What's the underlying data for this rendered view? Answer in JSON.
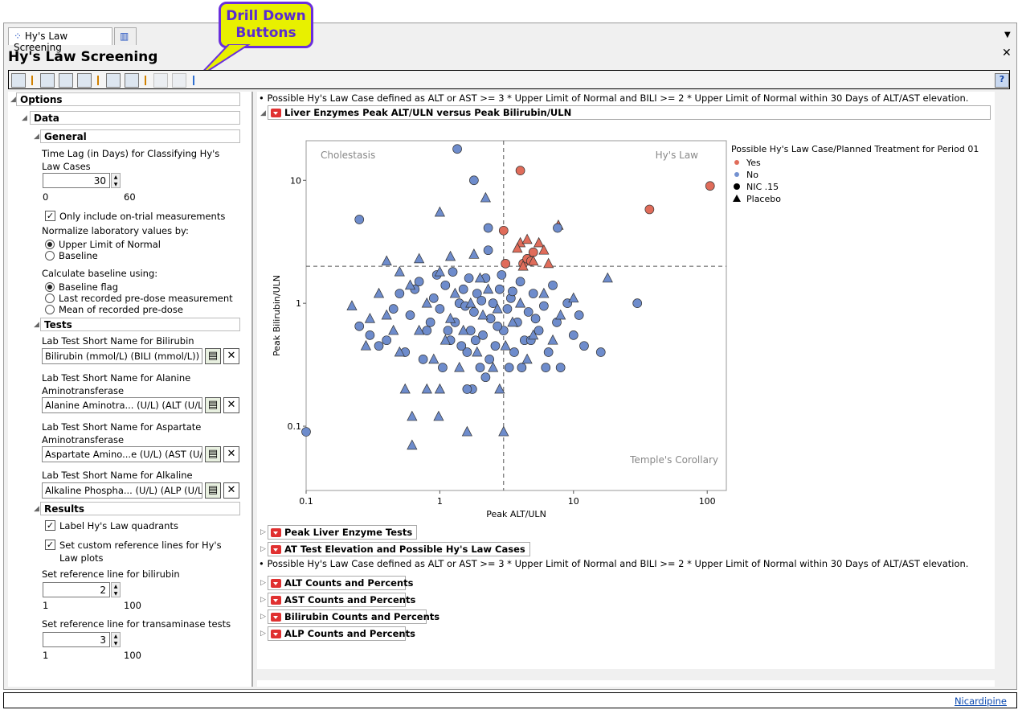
{
  "window": {
    "tab_label": "Hy's Law Screening",
    "title": "Hy's Law Screening",
    "callout": "Drill Down Buttons",
    "status_link": "Nicardipine"
  },
  "description": "Possible Hy's Law Case defined as ALT or AST >= 3 * Upper Limit of Normal and BILI >= 2 * Upper Limit of Normal within 30 Days of ALT/AST elevation.",
  "options": {
    "header": "Options",
    "data_header": "Data",
    "general_header": "General",
    "time_lag_label": "Time Lag (in Days) for Classifying Hy's Law Cases",
    "time_lag_value": "30",
    "time_lag_min": "0",
    "time_lag_max": "60",
    "on_trial_label": "Only include on-trial measurements",
    "on_trial_checked": true,
    "normalize_label": "Normalize laboratory values by:",
    "normalize_options": [
      "Upper Limit of Normal",
      "Baseline"
    ],
    "baseline_label": "Calculate baseline using:",
    "baseline_options": [
      "Baseline flag",
      "Last recorded pre-dose measurement",
      "Mean of recorded pre-dose measurements"
    ],
    "tests_header": "Tests",
    "tests": [
      {
        "label": "Lab Test Short Name for Bilirubin",
        "value": "Bilirubin (mmol/L) (BILI (mmol/L))"
      },
      {
        "label": "Lab Test Short Name for Alanine Aminotransferase",
        "value": "Alanine Aminotra... (U/L) (ALT (U/L))"
      },
      {
        "label": "Lab Test Short Name for Aspartate Aminotransferase",
        "value": "Aspartate Amino...e (U/L) (AST (U/L))"
      },
      {
        "label": "Lab Test Short Name for Alkaline Phosphatase",
        "value": "Alkaline Phospha... (U/L) (ALP (U/L))"
      }
    ],
    "results_header": "Results",
    "label_quadrants": "Label Hy's Law quadrants",
    "custom_ref": "Set custom reference lines for Hy's Law plots",
    "bili_ref_label": "Set reference line for bilirubin",
    "bili_ref_value": "2",
    "bili_min": "1",
    "bili_max": "100",
    "trans_ref_label": "Set reference line for transaminase tests",
    "trans_ref_value": "3",
    "trans_min": "1",
    "trans_max": "100"
  },
  "report": {
    "plot_node": "Liver Enzymes Peak ALT/ULN versus Peak Bilirubin/ULN",
    "nodes": [
      "Peak Liver Enzyme Tests",
      "AT Test Elevation and Possible Hy's Law Cases"
    ],
    "count_nodes": [
      "ALT Counts and Percents",
      "AST Counts and Percents",
      "Bilirubin Counts and Percents",
      "ALP Counts and Percents"
    ]
  },
  "chart_data": {
    "type": "scatter",
    "xlabel": "Peak ALT/ULN",
    "ylabel": "Peak Bilirubin/ULN",
    "xscale": "log",
    "yscale": "log",
    "xlim": [
      0.1,
      139
    ],
    "ylim": [
      0.03,
      21
    ],
    "xticks": [
      "0.1",
      "1",
      "10",
      "100"
    ],
    "yticks": [
      "0.1",
      "1",
      "10"
    ],
    "ref_x": 3,
    "ref_y": 2,
    "quadrant_labels": {
      "tl": "Cholestasis",
      "tr": "Hy's Law",
      "br": "Temple's Corollary"
    },
    "legend": {
      "title": "Possible Hy's Law Case/Planned Treatment for Period 01",
      "items": [
        {
          "label": "Yes",
          "color": "#e06c5a",
          "shape": "dot"
        },
        {
          "label": "No",
          "color": "#7391d0",
          "shape": "dot"
        },
        {
          "label": "NIC .15",
          "shape": "circle"
        },
        {
          "label": "Placebo",
          "shape": "triangle"
        }
      ],
      "position": "right"
    },
    "colors": {
      "Yes": "#e06c5a",
      "No": "#6e8ccc"
    },
    "points": [
      [
        4,
        12,
        "Y",
        "c"
      ],
      [
        3,
        3.9,
        "Y",
        "c"
      ],
      [
        37,
        5.8,
        "Y",
        "c"
      ],
      [
        105,
        9,
        "Y",
        "c"
      ],
      [
        3.1,
        2.1,
        "Y",
        "c"
      ],
      [
        4.2,
        2.1,
        "Y",
        "c"
      ],
      [
        4.5,
        2.3,
        "Y",
        "c"
      ],
      [
        5,
        2.6,
        "Y",
        "c"
      ],
      [
        4.8,
        2.2,
        "Y",
        "c"
      ],
      [
        4,
        3.1,
        "Y",
        "t"
      ],
      [
        4.5,
        3.3,
        "Y",
        "t"
      ],
      [
        5.5,
        3.1,
        "Y",
        "t"
      ],
      [
        6,
        2.7,
        "Y",
        "t"
      ],
      [
        7.7,
        4.3,
        "Y",
        "t"
      ],
      [
        4.2,
        2,
        "Y",
        "t"
      ],
      [
        5,
        2.2,
        "Y",
        "t"
      ],
      [
        6.5,
        2.1,
        "Y",
        "t"
      ],
      [
        3.8,
        2.8,
        "Y",
        "t"
      ],
      [
        1.35,
        18,
        "N",
        "c"
      ],
      [
        0.25,
        4.8,
        "N",
        "c"
      ],
      [
        1.8,
        10,
        "N",
        "c"
      ],
      [
        2.3,
        4.1,
        "N",
        "c"
      ],
      [
        30,
        1,
        "N",
        "c"
      ],
      [
        0.1,
        0.09,
        "N",
        "c"
      ],
      [
        16,
        0.4,
        "N",
        "c"
      ],
      [
        7.6,
        4.1,
        "N",
        "c"
      ],
      [
        2.3,
        2.7,
        "N",
        "c"
      ],
      [
        0.25,
        0.65,
        "N",
        "c"
      ],
      [
        2.2,
        7.2,
        "N",
        "t"
      ],
      [
        1,
        5.5,
        "N",
        "t"
      ],
      [
        0.98,
        0.12,
        "N",
        "t"
      ],
      [
        0.62,
        0.12,
        "N",
        "t"
      ],
      [
        0.62,
        0.07,
        "N",
        "t"
      ],
      [
        1.6,
        0.09,
        "N",
        "t"
      ],
      [
        3,
        0.09,
        "N",
        "t"
      ],
      [
        18,
        1.6,
        "N",
        "t"
      ],
      [
        0.22,
        0.95,
        "N",
        "t"
      ],
      [
        0.3,
        0.75,
        "N",
        "t"
      ],
      [
        0.5,
        1.2,
        "N",
        "c"
      ],
      [
        0.6,
        0.8,
        "N",
        "c"
      ],
      [
        0.7,
        1.5,
        "N",
        "c"
      ],
      [
        0.8,
        0.6,
        "N",
        "c"
      ],
      [
        0.9,
        1.1,
        "N",
        "c"
      ],
      [
        1.0,
        0.9,
        "N",
        "c"
      ],
      [
        1.1,
        1.4,
        "N",
        "c"
      ],
      [
        1.2,
        0.5,
        "N",
        "c"
      ],
      [
        1.3,
        0.7,
        "N",
        "c"
      ],
      [
        1.4,
        1.0,
        "N",
        "c"
      ],
      [
        1.5,
        1.3,
        "N",
        "c"
      ],
      [
        1.6,
        0.4,
        "N",
        "c"
      ],
      [
        1.7,
        0.6,
        "N",
        "c"
      ],
      [
        1.8,
        0.85,
        "N",
        "c"
      ],
      [
        1.9,
        1.2,
        "N",
        "c"
      ],
      [
        2.0,
        0.3,
        "N",
        "c"
      ],
      [
        2.1,
        0.55,
        "N",
        "c"
      ],
      [
        2.2,
        1.6,
        "N",
        "c"
      ],
      [
        2.4,
        0.75,
        "N",
        "c"
      ],
      [
        2.5,
        1.0,
        "N",
        "c"
      ],
      [
        2.6,
        0.45,
        "N",
        "c"
      ],
      [
        2.8,
        1.3,
        "N",
        "c"
      ],
      [
        3.0,
        0.6,
        "N",
        "c"
      ],
      [
        3.2,
        0.9,
        "N",
        "c"
      ],
      [
        3.4,
        1.1,
        "N",
        "c"
      ],
      [
        3.6,
        0.4,
        "N",
        "c"
      ],
      [
        3.8,
        0.7,
        "N",
        "c"
      ],
      [
        4.0,
        1.5,
        "N",
        "c"
      ],
      [
        4.3,
        0.5,
        "N",
        "c"
      ],
      [
        4.6,
        0.85,
        "N",
        "c"
      ],
      [
        5.0,
        1.2,
        "N",
        "c"
      ],
      [
        5.5,
        0.6,
        "N",
        "c"
      ],
      [
        6.0,
        0.95,
        "N",
        "c"
      ],
      [
        6.5,
        0.4,
        "N",
        "c"
      ],
      [
        7.0,
        1.4,
        "N",
        "c"
      ],
      [
        7.5,
        0.7,
        "N",
        "c"
      ],
      [
        8,
        0.3,
        "N",
        "c"
      ],
      [
        9,
        1.0,
        "N",
        "c"
      ],
      [
        10,
        0.55,
        "N",
        "c"
      ],
      [
        11,
        0.8,
        "N",
        "c"
      ],
      [
        0.4,
        0.5,
        "N",
        "c"
      ],
      [
        0.45,
        0.9,
        "N",
        "c"
      ],
      [
        0.55,
        0.4,
        "N",
        "c"
      ],
      [
        0.65,
        1.3,
        "N",
        "c"
      ],
      [
        0.75,
        0.35,
        "N",
        "c"
      ],
      [
        0.85,
        0.7,
        "N",
        "c"
      ],
      [
        0.95,
        1.7,
        "N",
        "c"
      ],
      [
        1.05,
        0.3,
        "N",
        "c"
      ],
      [
        1.15,
        0.6,
        "N",
        "c"
      ],
      [
        1.25,
        1.8,
        "N",
        "c"
      ],
      [
        1.45,
        0.45,
        "N",
        "c"
      ],
      [
        1.55,
        0.95,
        "N",
        "c"
      ],
      [
        1.65,
        1.6,
        "N",
        "c"
      ],
      [
        1.75,
        0.2,
        "N",
        "c"
      ],
      [
        1.85,
        0.5,
        "N",
        "c"
      ],
      [
        2.05,
        1.05,
        "N",
        "c"
      ],
      [
        2.35,
        0.35,
        "N",
        "c"
      ],
      [
        2.7,
        0.65,
        "N",
        "c"
      ],
      [
        2.9,
        1.7,
        "N",
        "c"
      ],
      [
        3.3,
        0.3,
        "N",
        "c"
      ],
      [
        3.5,
        1.25,
        "N",
        "c"
      ],
      [
        4.1,
        0.3,
        "N",
        "c"
      ],
      [
        4.8,
        0.5,
        "N",
        "c"
      ],
      [
        5.2,
        0.75,
        "N",
        "c"
      ],
      [
        6.2,
        0.3,
        "N",
        "c"
      ],
      [
        12,
        0.45,
        "N",
        "c"
      ],
      [
        0.35,
        0.45,
        "N",
        "c"
      ],
      [
        0.3,
        0.55,
        "N",
        "c"
      ],
      [
        1.6,
        0.2,
        "N",
        "c"
      ],
      [
        2.2,
        0.25,
        "N",
        "c"
      ],
      [
        0.4,
        0.8,
        "N",
        "t"
      ],
      [
        0.5,
        0.4,
        "N",
        "t"
      ],
      [
        0.6,
        1.4,
        "N",
        "t"
      ],
      [
        0.7,
        0.6,
        "N",
        "t"
      ],
      [
        0.8,
        1.0,
        "N",
        "t"
      ],
      [
        0.9,
        0.35,
        "N",
        "t"
      ],
      [
        1.0,
        1.8,
        "N",
        "t"
      ],
      [
        1.1,
        0.5,
        "N",
        "t"
      ],
      [
        1.2,
        0.75,
        "N",
        "t"
      ],
      [
        1.3,
        1.2,
        "N",
        "t"
      ],
      [
        1.4,
        0.3,
        "N",
        "t"
      ],
      [
        1.5,
        0.6,
        "N",
        "t"
      ],
      [
        1.7,
        1.0,
        "N",
        "t"
      ],
      [
        1.9,
        0.4,
        "N",
        "t"
      ],
      [
        2.1,
        0.8,
        "N",
        "t"
      ],
      [
        2.3,
        1.3,
        "N",
        "t"
      ],
      [
        2.5,
        0.3,
        "N",
        "t"
      ],
      [
        2.7,
        0.9,
        "N",
        "t"
      ],
      [
        3.1,
        0.45,
        "N",
        "t"
      ],
      [
        3.5,
        0.7,
        "N",
        "t"
      ],
      [
        4,
        1.0,
        "N",
        "t"
      ],
      [
        4.5,
        0.35,
        "N",
        "t"
      ],
      [
        5,
        0.55,
        "N",
        "t"
      ],
      [
        6,
        1.2,
        "N",
        "t"
      ],
      [
        7,
        0.5,
        "N",
        "t"
      ],
      [
        8,
        0.8,
        "N",
        "t"
      ],
      [
        10,
        1.1,
        "N",
        "t"
      ],
      [
        0.5,
        1.8,
        "N",
        "t"
      ],
      [
        0.7,
        2.3,
        "N",
        "t"
      ],
      [
        1.2,
        2.4,
        "N",
        "t"
      ],
      [
        0.35,
        1.2,
        "N",
        "t"
      ],
      [
        0.45,
        0.6,
        "N",
        "t"
      ],
      [
        0.55,
        0.2,
        "N",
        "t"
      ],
      [
        0.8,
        0.2,
        "N",
        "t"
      ],
      [
        1.0,
        0.2,
        "N",
        "t"
      ],
      [
        2.0,
        1.6,
        "N",
        "t"
      ],
      [
        2.8,
        0.2,
        "N",
        "t"
      ],
      [
        0.28,
        0.45,
        "N",
        "t"
      ],
      [
        1.8,
        2.5,
        "N",
        "t"
      ],
      [
        0.4,
        2.2,
        "N",
        "t"
      ]
    ]
  }
}
